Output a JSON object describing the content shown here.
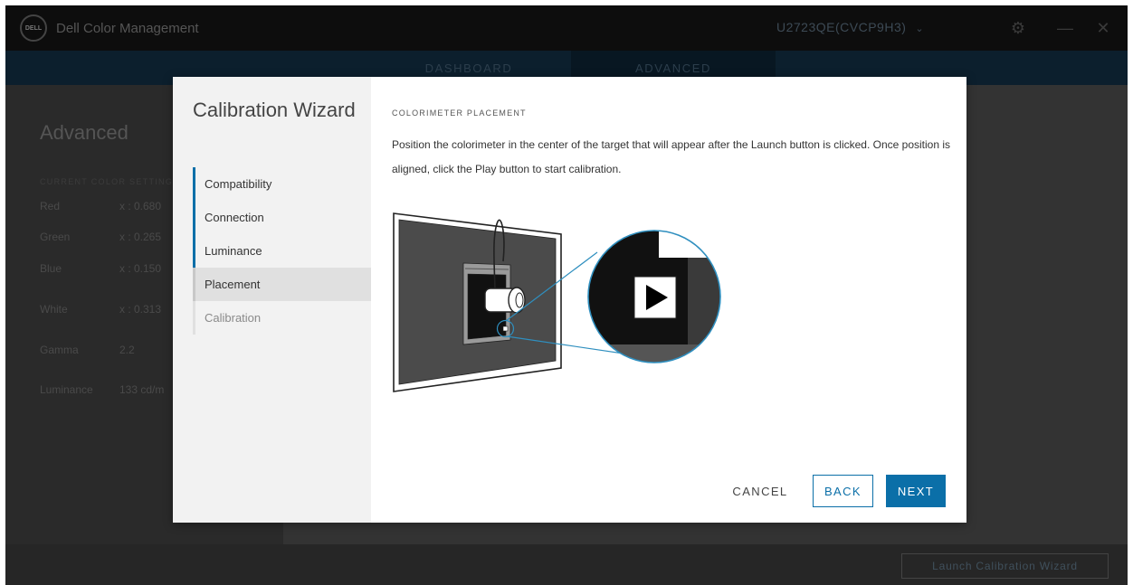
{
  "app": {
    "title": "Dell Color Management",
    "logo_text": "DELL",
    "monitor": "U2723QE(CVCP9H3)",
    "tabs": [
      "DASHBOARD",
      "ADVANCED"
    ],
    "active_tab": "ADVANCED"
  },
  "background": {
    "heading": "Advanced",
    "section": "CURRENT COLOR SETTINGS",
    "rows": [
      {
        "label": "Red",
        "value": "x : 0.680"
      },
      {
        "label": "Green",
        "value": "x : 0.265"
      },
      {
        "label": "Blue",
        "value": "x : 0.150"
      },
      {
        "label": "White",
        "value": "x : 0.313"
      },
      {
        "label": "Gamma",
        "value": "2.2"
      },
      {
        "label": "Luminance",
        "value": "133 cd/m"
      }
    ],
    "launch_button": "Launch Calibration Wizard"
  },
  "wizard": {
    "title": "Calibration Wizard",
    "steps": [
      {
        "label": "Compatibility",
        "state": "done"
      },
      {
        "label": "Connection",
        "state": "done"
      },
      {
        "label": "Luminance",
        "state": "done"
      },
      {
        "label": "Placement",
        "state": "current"
      },
      {
        "label": "Calibration",
        "state": "pending"
      }
    ],
    "section_label": "COLORIMETER PLACEMENT",
    "instructions": "Position the colorimeter in the center of the target that will appear after the Launch button is clicked. Once position is aligned, click the Play button to start calibration.",
    "buttons": {
      "cancel": "CANCEL",
      "back": "BACK",
      "next": "NEXT"
    }
  },
  "colors": {
    "accent": "#0b6fa8",
    "titlebar": "#0d0d0d",
    "navbar": "#0c1f2d"
  }
}
